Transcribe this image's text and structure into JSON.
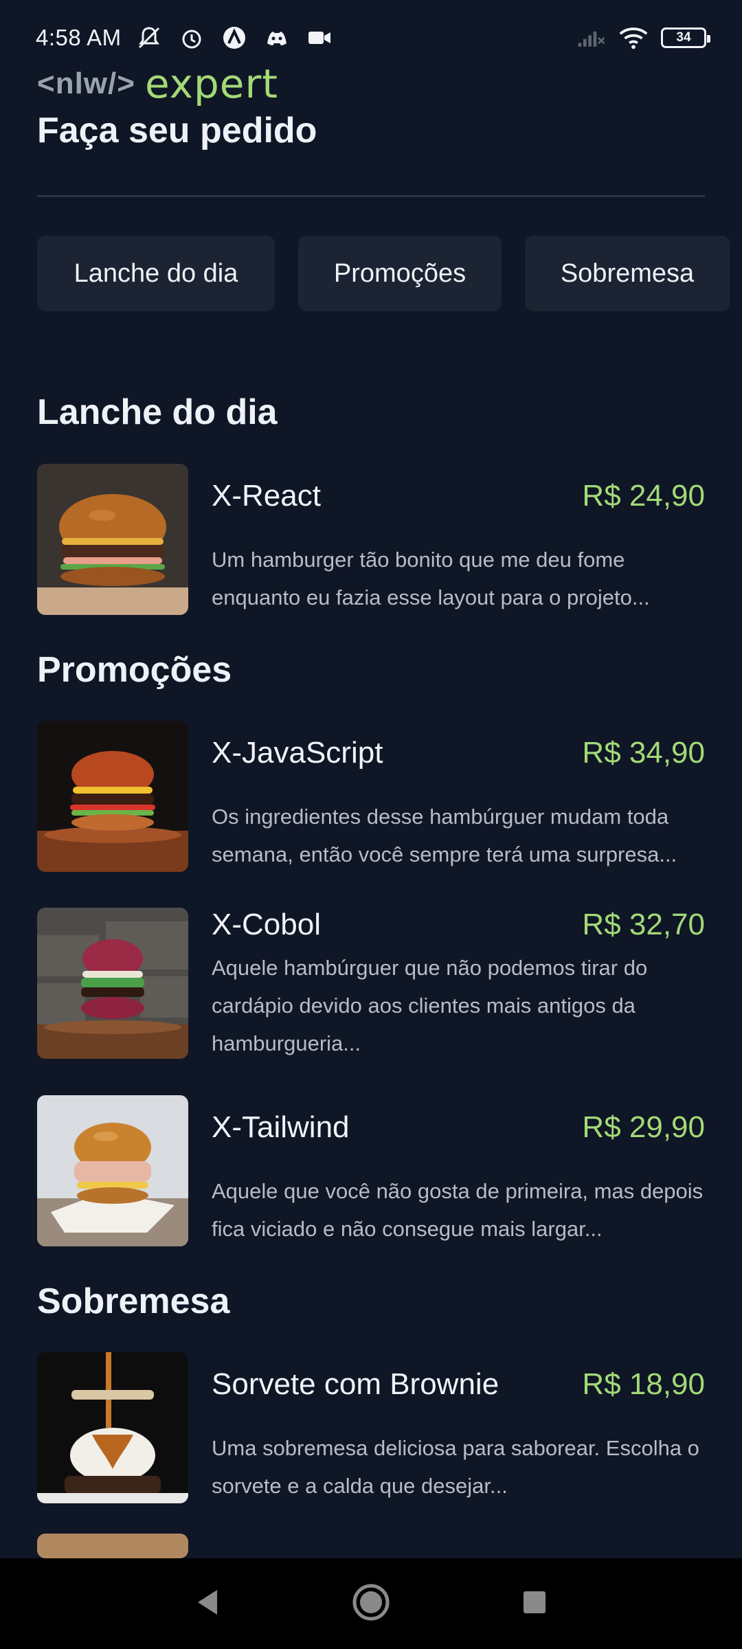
{
  "status_bar": {
    "time": "4:58 AM",
    "battery": "34",
    "icons": [
      "muted-bell-icon",
      "alarm-icon",
      "app-a-icon",
      "discord-icon",
      "video-icon",
      "no-signal-icon",
      "wifi-icon",
      "battery-icon"
    ]
  },
  "logo": {
    "nlw": "<nlw/>",
    "expert": "expert"
  },
  "page_title": "Faça seu pedido",
  "categories": [
    "Lanche do dia",
    "Promoções",
    "Sobremesa"
  ],
  "sections": [
    {
      "title": "Lanche do dia",
      "items": [
        {
          "name": "X-React",
          "price": "R$ 24,90",
          "description": "Um hamburger tão bonito que me deu fome enquanto eu fazia esse layout para o projeto..."
        }
      ]
    },
    {
      "title": "Promoções",
      "items": [
        {
          "name": "X-JavaScript",
          "price": "R$ 34,90",
          "description": "Os ingredientes desse hambúrguer mudam toda semana, então você sempre terá uma surpresa..."
        },
        {
          "name": "X-Cobol",
          "price": "R$ 32,70",
          "description": "Aquele hambúrguer que não podemos tirar do cardápio devido aos clientes mais antigos da hamburgueria..."
        },
        {
          "name": "X-Tailwind",
          "price": "R$ 29,90",
          "description": "Aquele que você não gosta de primeira, mas depois fica viciado e não consegue mais largar..."
        }
      ]
    },
    {
      "title": "Sobremesa",
      "items": [
        {
          "name": "Sorvete com Brownie",
          "price": "R$ 18,90",
          "description": "Uma sobremesa deliciosa para saborear. Escolha o sorvete e a calda que desejar..."
        }
      ]
    }
  ],
  "colors": {
    "background": "#0f1626",
    "accent": "#a3d977",
    "chip": "#1c2433"
  }
}
